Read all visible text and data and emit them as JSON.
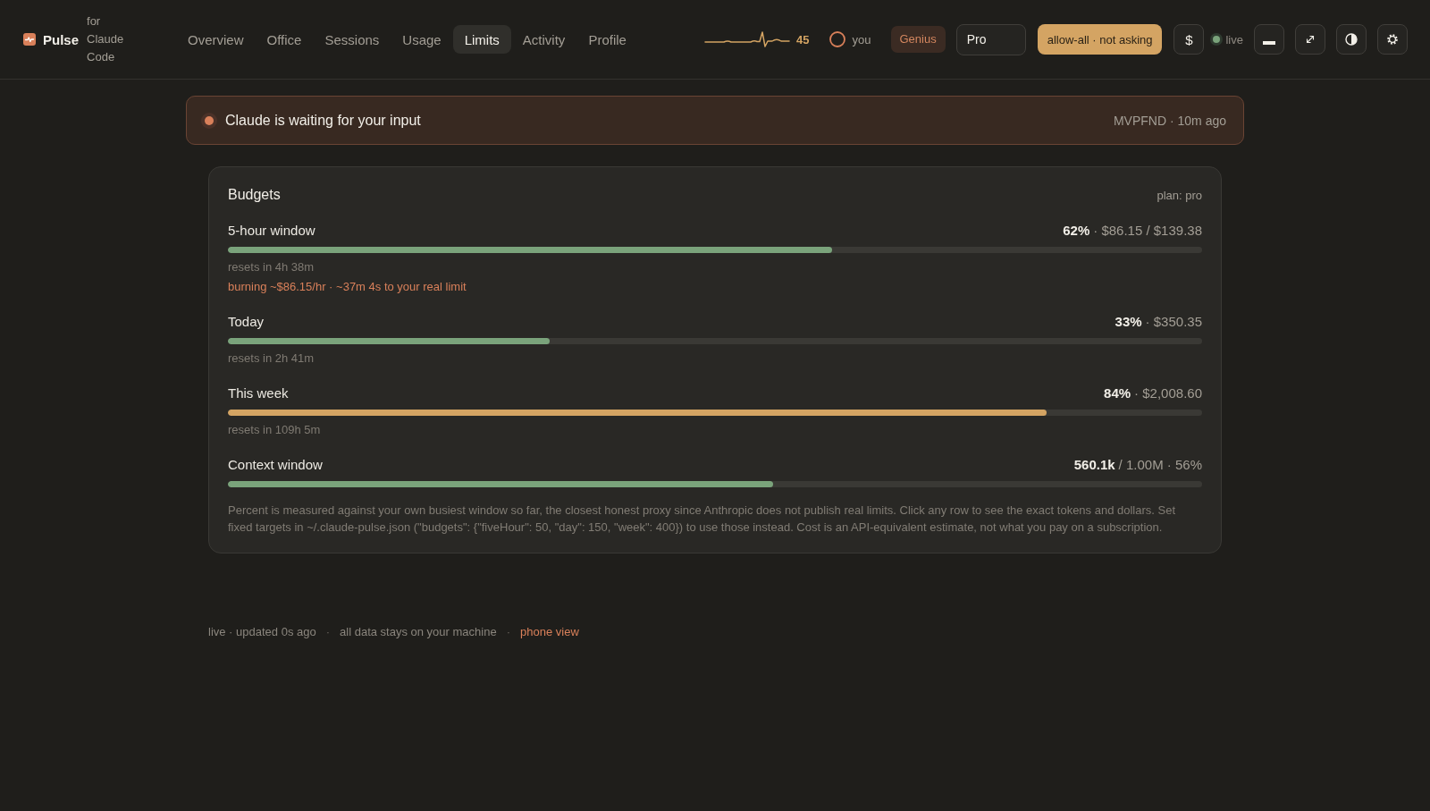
{
  "header": {
    "brand": {
      "name": "Pulse",
      "tagline": "for Claude Code"
    },
    "nav": [
      {
        "label": "Overview",
        "selected": false
      },
      {
        "label": "Office",
        "selected": false
      },
      {
        "label": "Sessions",
        "selected": false
      },
      {
        "label": "Usage",
        "selected": false
      },
      {
        "label": "Limits",
        "selected": true
      },
      {
        "label": "Activity",
        "selected": false
      },
      {
        "label": "Profile",
        "selected": false
      }
    ],
    "activity_count": "45",
    "user": "you",
    "tier_badge": "Genius",
    "plan_field": {
      "value": "Pro"
    },
    "permission_button": "allow-all · not asking",
    "cost_button": "$",
    "connection": {
      "label": "live"
    }
  },
  "banner": {
    "message": "Claude is waiting for your input",
    "meta": "MVPFND · 10m ago"
  },
  "budgets_card": {
    "title": "Budgets",
    "plan": "plan: pro",
    "budgets": [
      {
        "label": "5-hour window",
        "value": "62%",
        "detail": "· $86.15 / $139.38",
        "level": 0.62,
        "color": "#7aa37b",
        "reset": "resets in 4h 38m",
        "warning": "burning ~$86.15/hr · ~37m 4s to your real limit"
      },
      {
        "label": "Today",
        "value": "33%",
        "detail": "· $350.35",
        "level": 0.33,
        "color": "#7aa37b",
        "reset": "resets in 2h 41m"
      },
      {
        "label": "This week",
        "value": "84%",
        "detail": "· $2,008.60",
        "level": 0.84,
        "color": "#d4a463",
        "reset": "resets in 109h 5m"
      },
      {
        "label": "Context window",
        "value": "560.1k",
        "detail": "/ 1.00M · 56%",
        "level": 0.56,
        "color": "#7aa37b"
      }
    ],
    "note": "Percent is measured against your own busiest window so far, the closest honest proxy since Anthropic does not publish real limits. Click any row to see the exact tokens and dollars. Set fixed targets in ~/.claude-pulse.json (\"budgets\": {\"fiveHour\": 50, \"day\": 150, \"week\": 400}) to use those instead. Cost is an API-equivalent estimate, not what you pay on a subscription."
  },
  "footer": [
    {
      "kind": "text",
      "text": "live · updated 0s ago"
    },
    {
      "kind": "separator",
      "text": "·"
    },
    {
      "kind": "text",
      "text": "all data stays on your machine"
    },
    {
      "kind": "separator",
      "text": "·"
    },
    {
      "kind": "link",
      "text": "phone view"
    }
  ]
}
